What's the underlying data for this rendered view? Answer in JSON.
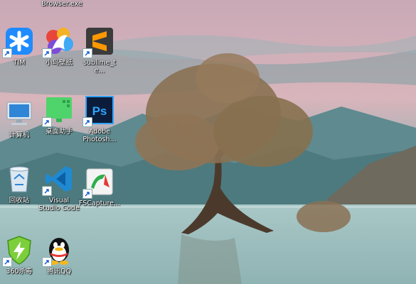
{
  "desktop": {
    "top_partial_label": "Browser.exe",
    "icons": [
      {
        "id": "tim",
        "label": "TIM"
      },
      {
        "id": "xiaoniao",
        "label": "小鸟壁纸"
      },
      {
        "id": "sublime",
        "label": "sublime_te..."
      },
      {
        "id": "computer",
        "label": "计算机"
      },
      {
        "id": "desktop-assistant",
        "label": "桌面助手"
      },
      {
        "id": "photoshop",
        "label": "Adobe\nPhotosh..."
      },
      {
        "id": "recycle-bin",
        "label": "回收站"
      },
      {
        "id": "vscode",
        "label": "Visual\nStudio Code"
      },
      {
        "id": "fscapture",
        "label": "FSCapture..."
      },
      {
        "id": "360",
        "label": "360杀毒"
      },
      {
        "id": "qq",
        "label": "腾讯QQ"
      }
    ]
  }
}
